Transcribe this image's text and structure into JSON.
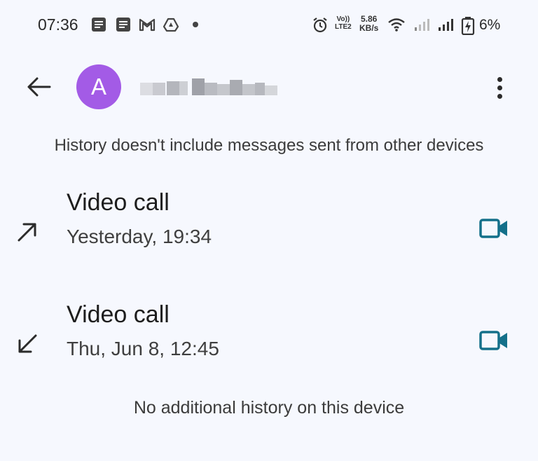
{
  "status_bar": {
    "time": "07:36",
    "icons": [
      "doc-notification-icon",
      "doc-notification-icon",
      "gmail-icon",
      "drive-icon",
      "more-notifications-dot"
    ],
    "volte_line1": "Vo))",
    "volte_line2": "LTE2",
    "speed_value": "5.86",
    "speed_unit": "KB/s",
    "battery_percent": "6%"
  },
  "app_bar": {
    "avatar_letter": "A",
    "contact_name_blurred": true
  },
  "history_note": "History doesn't include messages sent from other devices",
  "calls": [
    {
      "title": "Video call",
      "time": "Yesterday, 19:34",
      "direction": "outgoing",
      "direction_icon": "arrow-up-right-icon",
      "action_icon": "video-camera-icon"
    },
    {
      "title": "Video call",
      "time": "Thu, Jun 8, 12:45",
      "direction": "incoming",
      "direction_icon": "arrow-down-left-icon",
      "action_icon": "video-camera-icon"
    }
  ],
  "footer_note": "No additional history on this device",
  "colors": {
    "background": "#f6f8fe",
    "avatar": "#a35be6",
    "video_icon": "#14708a"
  }
}
